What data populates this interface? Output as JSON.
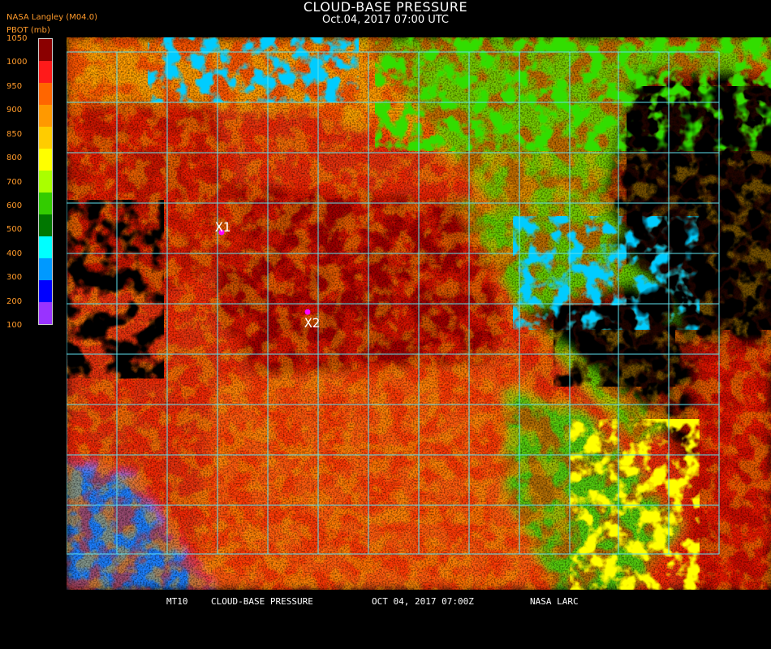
{
  "header": {
    "title": "CLOUD-BASE PRESSURE",
    "subtitle": "Oct.04, 2017 07:00 UTC",
    "source": "NASA Langley (M04.0)",
    "variable": "PBOT (mb)"
  },
  "legend": {
    "ticks": [
      "1050",
      "1000",
      "950",
      "900",
      "850",
      "800",
      "700",
      "600",
      "500",
      "400",
      "300",
      "200",
      "100"
    ],
    "colors": [
      "#8b0000",
      "#ff1a1a",
      "#ff6600",
      "#ff9900",
      "#ffcc00",
      "#ffff00",
      "#aaff00",
      "#33cc00",
      "#007700",
      "#00ffff",
      "#0099ff",
      "#0000ff",
      "#9933ff"
    ]
  },
  "markers": [
    {
      "label": "X1",
      "color": "#ff00ff"
    },
    {
      "label": "X2",
      "color": "#ff00ff"
    }
  ],
  "footer": {
    "satellite": "MT10",
    "product": "CLOUD-BASE PRESSURE",
    "datetime": "OCT 04, 2017 07:00Z",
    "agency": "NASA LARC"
  }
}
